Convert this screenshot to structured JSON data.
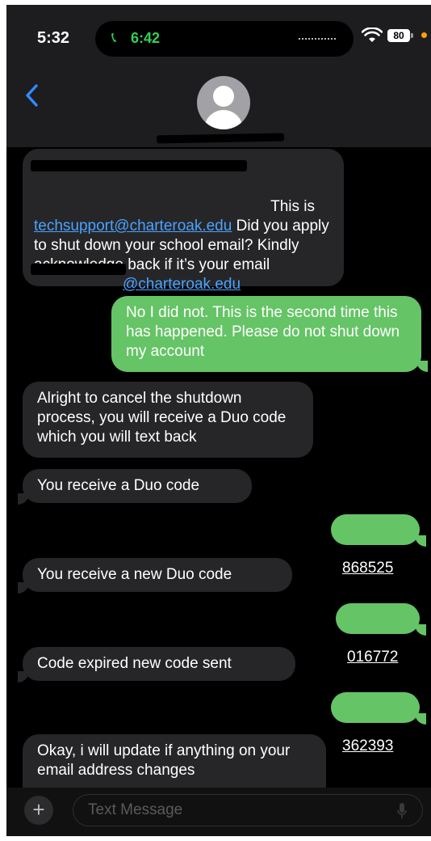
{
  "status_bar": {
    "time": "5:32",
    "call_time": "6:42",
    "battery": "80"
  },
  "messages": [
    {
      "direction": "incoming",
      "parts": [
        {
          "text": "This is "
        },
        {
          "text": "techsupport@charteroak.edu",
          "link": true
        },
        {
          "text": " Did you apply to shut down your school email? Kindly acknowledge back if it’s your email "
        },
        {
          "text": "@charteroak.edu",
          "link": true
        }
      ]
    },
    {
      "direction": "outgoing",
      "text": "No I did not. This is the second time this has happened. Please do not shut down my account"
    },
    {
      "direction": "incoming",
      "text": "Alright to cancel the shutdown process, you will receive a Duo code which you will text back"
    },
    {
      "direction": "incoming",
      "text": "You receive a Duo code"
    },
    {
      "direction": "outgoing",
      "text": "868525"
    },
    {
      "direction": "incoming",
      "text": "You receive a new Duo code"
    },
    {
      "direction": "outgoing",
      "text": "016772"
    },
    {
      "direction": "incoming",
      "text": "Code expired new code sent"
    },
    {
      "direction": "outgoing",
      "text": "362393"
    },
    {
      "direction": "incoming",
      "text": "Okay, i will update if anything on your email address changes"
    }
  ],
  "composer": {
    "placeholder": "Text Message",
    "plus_label": "+"
  },
  "colors": {
    "incoming_bubble": "#262629",
    "outgoing_bubble": "#65c466",
    "link": "#4aa3ff",
    "call_green": "#30d158"
  },
  "icons": [
    "back-chevron-icon",
    "phone-icon",
    "wifi-icon",
    "battery-icon",
    "avatar-icon",
    "plus-icon",
    "microphone-icon"
  ]
}
